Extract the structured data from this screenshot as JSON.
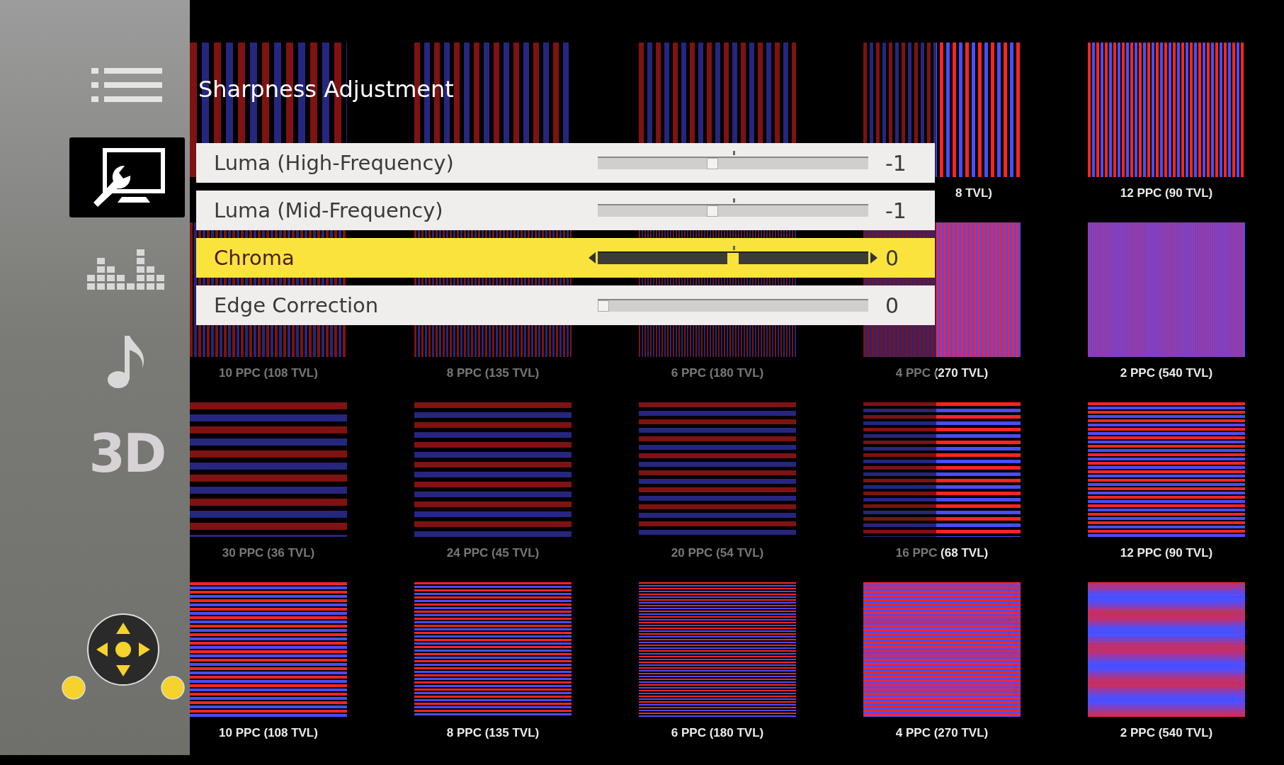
{
  "sidebar": {
    "items": [
      {
        "kind": "list",
        "selected": false
      },
      {
        "kind": "picture-tools",
        "selected": true
      },
      {
        "kind": "equalizer",
        "selected": false
      },
      {
        "kind": "music",
        "selected": false
      },
      {
        "kind": "text",
        "label": "3D",
        "selected": false
      }
    ]
  },
  "test_pattern": {
    "rows": [
      {
        "cells": [
          {
            "kind": "vertical"
          },
          {
            "kind": "vertical"
          },
          {
            "kind": "vertical"
          },
          {
            "kind": "vertical",
            "label": "8 TVL)",
            "partly_hidden": true
          },
          {
            "kind": "vertical",
            "label": "12 PPC (90 TVL)",
            "partly_hidden": false
          }
        ]
      },
      {
        "cells": [
          {
            "kind": "vertical",
            "label": "10 PPC (108 TVL)",
            "partly_hidden": false
          },
          {
            "kind": "vertical",
            "label": "8 PPC (135 TVL)",
            "partly_hidden": false
          },
          {
            "kind": "vertical",
            "label": "6 PPC (180 TVL)",
            "partly_hidden": false
          },
          {
            "kind": "vertical",
            "label": "4 PPC (270 TVL)",
            "partly_hidden": false
          },
          {
            "kind": "vertical",
            "label": "2 PPC (540 TVL)",
            "partly_hidden": false
          }
        ]
      },
      {
        "cells": [
          {
            "kind": "horizontal",
            "label": "30 PPC (36 TVL)",
            "partly_hidden": false
          },
          {
            "kind": "horizontal",
            "label": "24 PPC (45 TVL)",
            "partly_hidden": false
          },
          {
            "kind": "horizontal",
            "label": "20 PPC (54 TVL)",
            "partly_hidden": false
          },
          {
            "kind": "horizontal",
            "label": "16 PPC (68 TVL)",
            "partly_hidden": false
          },
          {
            "kind": "horizontal",
            "label": "12 PPC (90 TVL)",
            "partly_hidden": false
          }
        ]
      },
      {
        "cells": [
          {
            "kind": "horizontal",
            "label": "10 PPC (108 TVL)",
            "partly_hidden": false
          },
          {
            "kind": "horizontal",
            "label": "8 PPC (135 TVL)",
            "partly_hidden": false
          },
          {
            "kind": "horizontal",
            "label": "6 PPC (180 TVL)",
            "partly_hidden": false
          },
          {
            "kind": "horizontal",
            "label": "4 PPC (270 TVL)",
            "partly_hidden": false
          },
          {
            "kind": "horizontal",
            "label": "2 PPC (540 TVL)",
            "partly_hidden": false
          }
        ]
      }
    ]
  },
  "menu": {
    "title": "Sharpness Adjustment",
    "items": [
      {
        "label": "Luma (High-Frequency)",
        "kind": "bipolar",
        "level": 0.42,
        "value": "-1",
        "selected": false
      },
      {
        "label": "Luma (Mid-Frequency)",
        "kind": "bipolar",
        "level": 0.42,
        "value": "-1",
        "selected": false
      },
      {
        "label": "Chroma",
        "kind": "bipolar",
        "level": 0.5,
        "value": "0",
        "selected": true
      },
      {
        "label": "Edge Correction",
        "kind": "unipolar",
        "level": 0,
        "value": "0",
        "selected": false
      }
    ]
  }
}
